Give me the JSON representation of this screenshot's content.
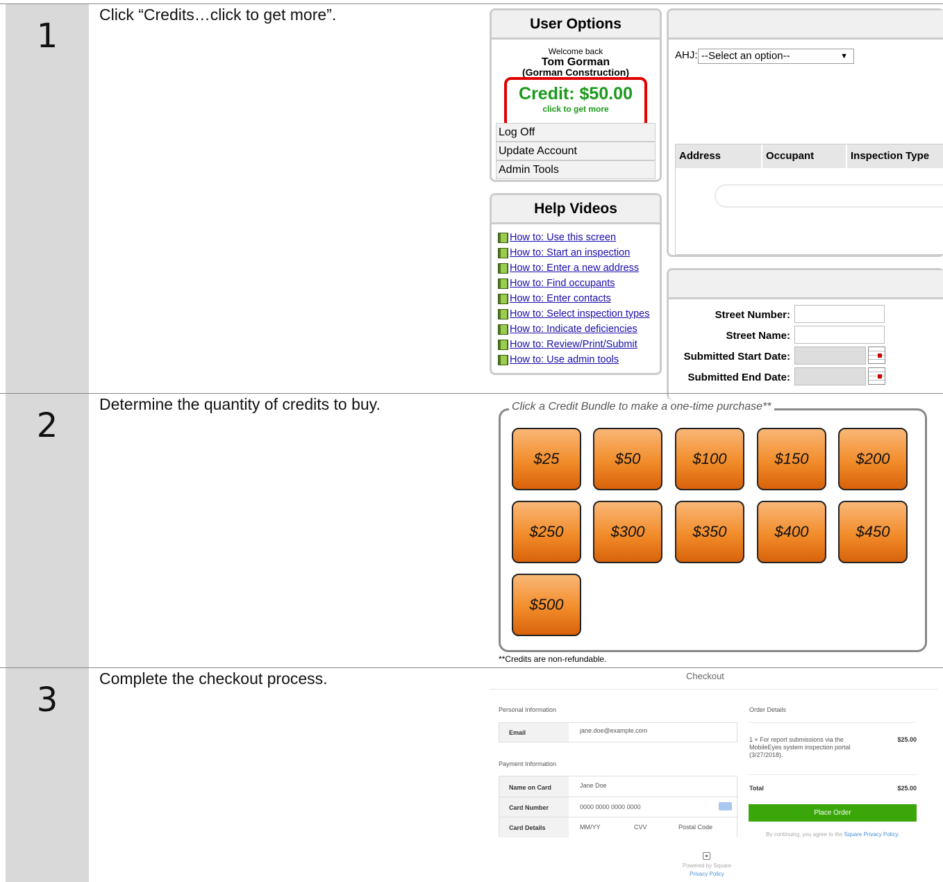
{
  "steps": [
    {
      "number": "1",
      "text": "Click “Credits…click to get more”."
    },
    {
      "number": "2",
      "text": "Determine the quantity of credits to buy."
    },
    {
      "number": "3",
      "text": "Complete the checkout process."
    }
  ],
  "user_options": {
    "title": "User Options",
    "welcome": "Welcome back",
    "user_name": "Tom Gorman",
    "company": "(Gorman Construction)",
    "credit": "Credit: $50.00",
    "credit_link": "click to get more",
    "menu": [
      "Log Off",
      "Update Account",
      "Admin Tools"
    ]
  },
  "help_videos": {
    "title": "Help Videos",
    "links": [
      "How to: Use this screen",
      "How to: Start an inspection",
      "How to: Enter a new address",
      "How to: Find occupants",
      "How to: Enter contacts",
      "How to: Select inspection types",
      "How to: Indicate deficiencies",
      "How to: Review/Print/Submit",
      "How to: Use admin tools"
    ]
  },
  "ahj": {
    "label": "AHJ:",
    "select": "--Select an option--"
  },
  "table_headers": [
    "Address",
    "Occupant",
    "Inspection Type"
  ],
  "search": {
    "street_number": "Street Number:",
    "street_name": "Street Name:",
    "start_date": "Submitted Start Date:",
    "end_date": "Submitted End Date:"
  },
  "bundles": {
    "legend": "Click a Credit Bundle to make a one-time purchase**",
    "items": [
      "$25",
      "$50",
      "$100",
      "$150",
      "$200",
      "$250",
      "$300",
      "$350",
      "$400",
      "$450",
      "$500"
    ],
    "note": "**Credits are non-refundable."
  },
  "checkout": {
    "title": "Checkout",
    "personal_heading": "Personal Information",
    "email_label": "Email",
    "email_value": "jane.doe@example.com",
    "payment_heading": "Payment Information",
    "name_label": "Name on Card",
    "name_value": "Jane Doe",
    "card_label": "Card Number",
    "card_value": "0000 0000 0000 0000",
    "details_label": "Card Details",
    "mmyy": "MM/YY",
    "cvv": "CVV",
    "postal": "Postal Code",
    "order_heading": "Order Details",
    "order_item": "1 × For report submissions via the MobileEyes system inspection portal (3/27/2018).",
    "order_price": "$25.00",
    "total_label": "Total",
    "total_value": "$25.00",
    "place_order": "Place Order",
    "agree_prefix": "By continuing, you agree to the ",
    "agree_link": "Square Privacy Policy.",
    "powered": "Powered by Square",
    "privacy": "Privacy Policy"
  },
  "colors": {
    "credit_green": "#1a9a1a",
    "highlight_red": "#e00000",
    "order_green": "#3aa60a",
    "bundle_orange": "#f28c2a",
    "link_blue": "#1a0dab"
  }
}
